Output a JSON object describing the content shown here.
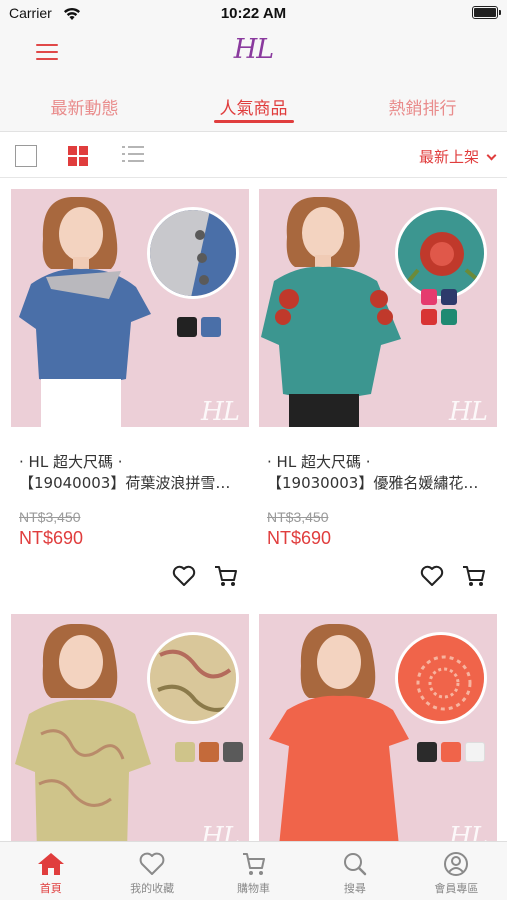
{
  "status_bar": {
    "carrier": "Carrier",
    "time": "10:22 AM"
  },
  "header": {
    "logo": "HL",
    "menu_icon": "hamburger-menu-icon"
  },
  "tabs": [
    {
      "label": "最新動態",
      "active": false
    },
    {
      "label": "人氣商品",
      "active": true
    },
    {
      "label": "熱銷排行",
      "active": false
    }
  ],
  "toolbar": {
    "sort_label": "最新上架",
    "active_view": "grid"
  },
  "products": [
    {
      "name_line1": "· HL 超大尺碼 ·",
      "name_line2": "【19040003】荷葉波浪拼雪…",
      "old_price": "NT$3,450",
      "price": "NT$690",
      "watermark": "HL"
    },
    {
      "name_line1": "· HL 超大尺碼 ·",
      "name_line2": "【19030003】優雅名媛繡花…",
      "old_price": "NT$3,450",
      "price": "NT$690",
      "watermark": "HL"
    },
    {
      "watermark": "HL"
    },
    {
      "watermark": "HL"
    }
  ],
  "bottom_nav": [
    {
      "label": "首頁",
      "icon": "home-icon",
      "active": true
    },
    {
      "label": "我的收藏",
      "icon": "heart-icon",
      "active": false
    },
    {
      "label": "購物車",
      "icon": "cart-icon",
      "active": false
    },
    {
      "label": "搜尋",
      "icon": "search-icon",
      "active": false
    },
    {
      "label": "會員專區",
      "icon": "user-icon",
      "active": false
    }
  ],
  "colors": {
    "accent": "#e03d3d",
    "accent_light": "#e98c8c",
    "logo": "#8a3a9e",
    "photo_bg": "#e9c9d2"
  }
}
